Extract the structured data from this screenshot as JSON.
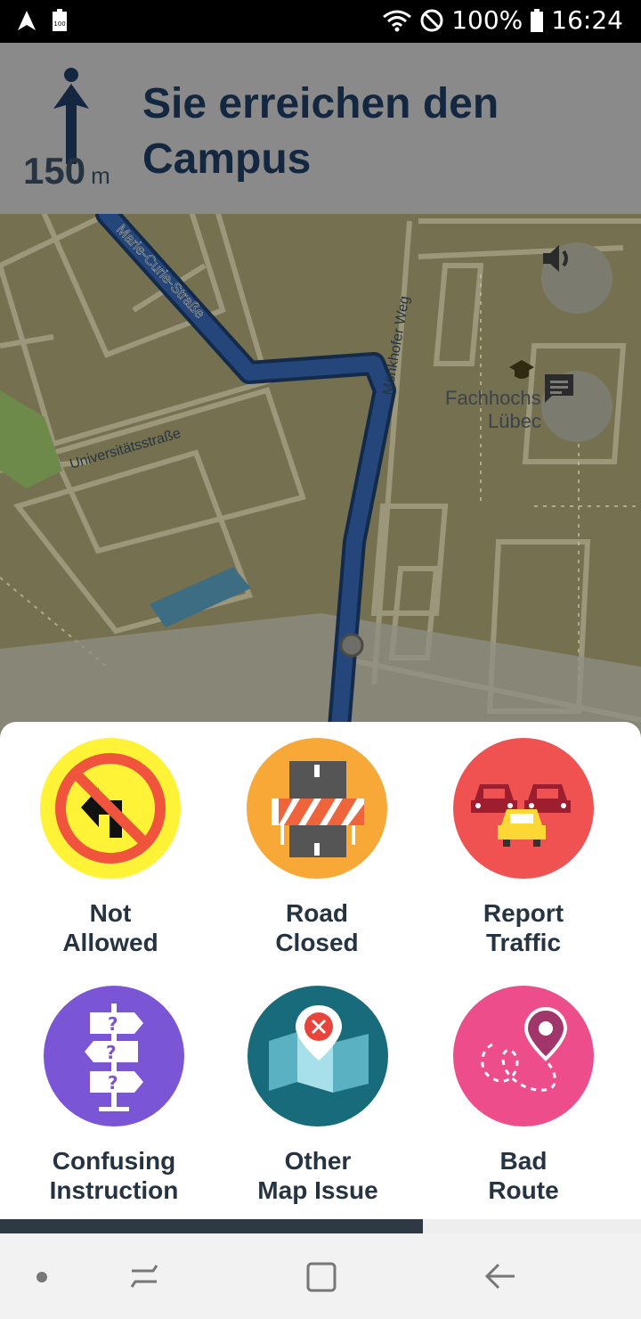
{
  "status_bar": {
    "battery_percent": "100%",
    "time": "16:24",
    "battery_badge": "100"
  },
  "navigation": {
    "distance_value": "150",
    "distance_unit": "m",
    "instruction": "Sie erreichen den Campus"
  },
  "map": {
    "street_labels": [
      "Marie-Curie-Straße",
      "Universitätsstraße",
      "Mönkhofer Weg",
      "Fachhochs",
      "Lübec"
    ],
    "route_color": "#1e3a66"
  },
  "reports": [
    {
      "line1": "Not",
      "line2": "Allowed",
      "color": "#fef337",
      "icon": "no-left-turn-icon"
    },
    {
      "line1": "Road",
      "line2": "Closed",
      "color": "#f8a836",
      "icon": "road-barrier-icon"
    },
    {
      "line1": "Report",
      "line2": "Traffic",
      "color": "#f05252",
      "icon": "traffic-cars-icon"
    },
    {
      "line1": "Confusing",
      "line2": "Instruction",
      "color": "#7a56d6",
      "icon": "question-signpost-icon"
    },
    {
      "line1": "Other",
      "line2": "Map Issue",
      "color": "#186b7b",
      "icon": "map-pin-error-icon"
    },
    {
      "line1": "Bad",
      "line2": "Route",
      "color": "#ed4d8a",
      "icon": "bad-route-icon"
    }
  ],
  "sheet_progress": 0.66
}
